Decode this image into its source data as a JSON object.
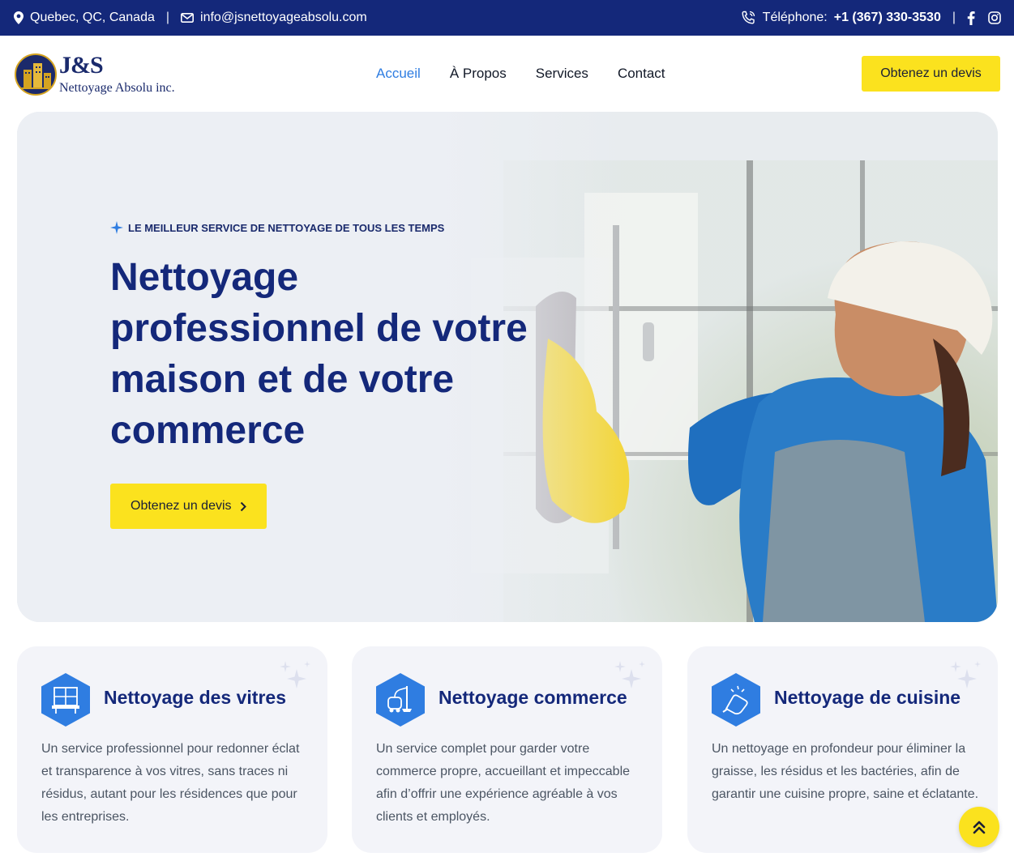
{
  "topbar": {
    "location": "Quebec, QC, Canada",
    "separator": "|",
    "email": "info@jsnettoyageabsolu.com",
    "phone_label": "Téléphone:",
    "phone_number": "+1 (367) 330-3530",
    "icons": [
      "map-pin-icon",
      "envelope-icon",
      "phone-icon",
      "facebook-icon",
      "instagram-icon"
    ]
  },
  "header": {
    "logo_title": "J&S",
    "logo_subtitle": "Nettoyage Absolu inc.",
    "nav": [
      "Accueil",
      "À Propos",
      "Services",
      "Contact"
    ],
    "active_nav": "Accueil",
    "cta": "Obtenez un devis"
  },
  "hero": {
    "eyebrow": "LE MEILLEUR SERVICE DE NETTOYAGE DE TOUS LES TEMPS",
    "title": "Nettoyage professionnel de votre maison et de votre commerce",
    "button": "Obtenez un devis"
  },
  "cards": [
    {
      "icon": "window-cleaning-icon",
      "title": "Nettoyage des vitres",
      "text": "Un service professionnel pour redonner éclat et transparence à vos vitres, sans traces ni résidus, autant pour les résidences que pour les entreprises."
    },
    {
      "icon": "vacuum-cleaner-icon",
      "title": "Nettoyage commerce",
      "text": "Un service complet pour garder votre commerce propre, accueillant et impeccable afin d’offrir une expérience agréable à vos clients et employés."
    },
    {
      "icon": "hand-wiping-icon",
      "title": "Nettoyage de cuisine",
      "text": "Un nettoyage en profondeur pour éliminer la graisse, les résidus et les bactéries, afin de garantir une cuisine propre, saine et éclatante."
    }
  ],
  "colors": {
    "navy": "#14287a",
    "accent_blue": "#2f7de1",
    "yellow": "#fbe21e",
    "card_bg": "#f3f4f9"
  }
}
